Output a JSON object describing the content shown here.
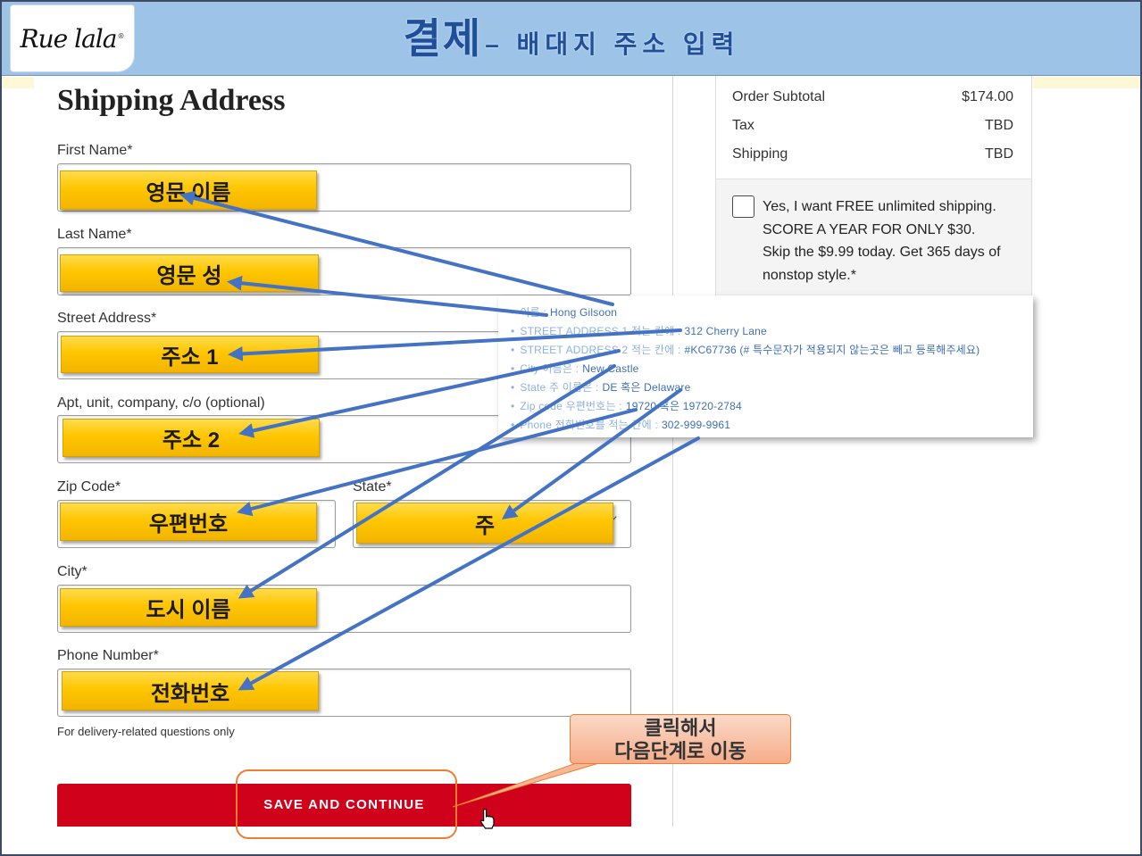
{
  "slide": {
    "logo_text": "Rue lala",
    "logo_mark": "®",
    "title_main": "결제",
    "title_sub": "– 배대지 주소 입력"
  },
  "form": {
    "heading": "Shipping Address",
    "first_name_label": "First Name*",
    "last_name_label": "Last Name*",
    "street_label": "Street Address*",
    "apt_label": "Apt, unit, company, c/o (optional)",
    "zip_label": "Zip Code*",
    "state_label": "State*",
    "city_label": "City*",
    "phone_label": "Phone Number*",
    "phone_helper": "For delivery-related questions only",
    "submit_label": "SAVE AND CONTINUE"
  },
  "annotations": {
    "first_name": "영문 이름",
    "last_name": "영문 성",
    "street1": "주소 1",
    "street2": "주소 2",
    "zip": "우편번호",
    "state": "주",
    "city": "도시 이름",
    "phone": "전화번호"
  },
  "info_box": {
    "lines": [
      {
        "label": "이름 :",
        "value": "Hong Gilsoon"
      },
      {
        "label": "STREET ADDRESS 1 적는 칸에 :",
        "value": "312 Cherry Lane"
      },
      {
        "label": "STREET ADDRESS 2 적는 칸에 :",
        "value": "#KC67736 (# 특수문자가 적용되지 않는곳은 빼고 등록해주세요)"
      },
      {
        "label": "City 이름은 :",
        "value": "New Castle"
      },
      {
        "label": "State 주 이름은 :",
        "value": "DE 혹은 Delaware"
      },
      {
        "label": "Zip code 우편번호는 :",
        "value": "19720 혹은 19720-2784"
      },
      {
        "label": "Phone 전화번호를 적는 칸에 :",
        "value": "302-999-9961"
      }
    ]
  },
  "callout": {
    "line1": "클릭해서",
    "line2": "다음단계로 이동"
  },
  "order_summary": {
    "rows": [
      {
        "label": "Order Subtotal",
        "value": "$174.00"
      },
      {
        "label": "Tax",
        "value": "TBD"
      },
      {
        "label": "Shipping",
        "value": "TBD"
      }
    ],
    "promo": {
      "checked": false,
      "lines": [
        "Yes, I want FREE unlimited shipping.",
        "SCORE A YEAR FOR ONLY $30.",
        "Skip the $9.99 today. Get 365 days of",
        "nonstop style.*"
      ]
    }
  },
  "icons": {
    "cursor": "hand-cursor-icon",
    "state_dropdown": "chevron-down-icon",
    "promo_checkbox": "checkbox-icon"
  },
  "colors": {
    "header_bg": "#9dc3e6",
    "title_color": "#1f4e9a",
    "accent_red": "#d0021b",
    "highlight_orange": "#ed7d31",
    "arrow_blue": "#4472c4",
    "overlay_yellow": "#ffc600",
    "info_label": "#8db2df",
    "info_value": "#3e70b6"
  }
}
